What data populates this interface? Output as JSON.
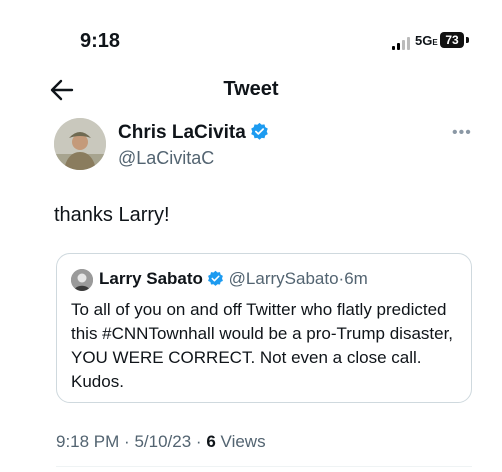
{
  "status_bar": {
    "time": "9:18",
    "network": "5G",
    "network_sub": "E",
    "battery": "73"
  },
  "nav": {
    "title": "Tweet",
    "back_icon": "arrow-left-icon"
  },
  "tweet": {
    "author_name": "Chris LaCivita",
    "author_handle": "@LaCivitaC",
    "text": "thanks Larry!",
    "more_icon": "ellipsis-icon",
    "verified_color": "#1d9bf0"
  },
  "quote": {
    "author_name": "Larry Sabato",
    "author_handle": "@LarrySabato",
    "separator": "·",
    "age": "6m",
    "text": "To all of you on and off Twitter who flatly predicted this #CNNTownhall would be a pro-Trump disaster, YOU WERE CORRECT. Not even a close call. Kudos."
  },
  "meta": {
    "time": "9:18 PM",
    "date": "5/10/23",
    "separator": "·",
    "views_count": "6",
    "views_label": "Views"
  }
}
